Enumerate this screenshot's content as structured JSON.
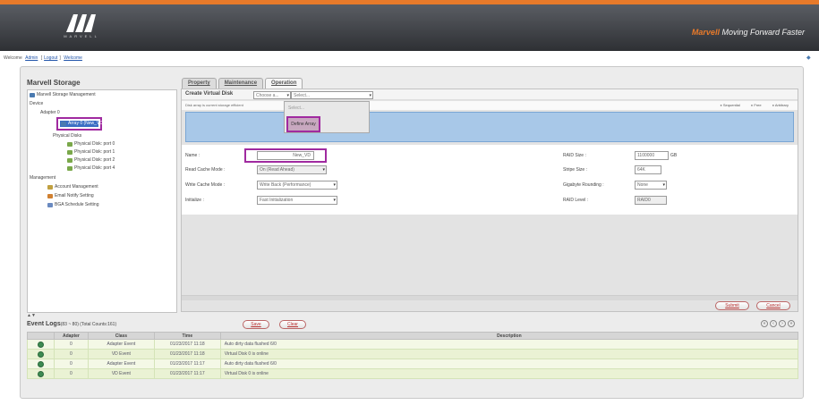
{
  "header": {
    "logo_text": "MARVELL",
    "tagline_brand": "Marvell",
    "tagline": "Moving Forward Faster"
  },
  "welcome": {
    "prefix": "Welcome",
    "user": "Admin",
    "logout": "Logout",
    "extra": "Welcome"
  },
  "left": {
    "title": "Marvell Storage",
    "tree": [
      {
        "label": "Marvell Storage Management",
        "icon": "tree-root-icon"
      },
      {
        "label": "Device",
        "icon": ""
      },
      {
        "label": "Adapter 0",
        "icon": ""
      },
      {
        "label": "Array 0 (New_VD)",
        "icon": "virtual-disk-icon"
      },
      {
        "label": "Physical Disks",
        "icon": ""
      },
      {
        "label": "Physical Disk: port 0",
        "icon": "physical-disk-icon"
      },
      {
        "label": "Physical Disk: port 1",
        "icon": "physical-disk-icon"
      },
      {
        "label": "Physical Disk: port 2",
        "icon": "physical-disk-icon"
      },
      {
        "label": "Physical Disk: port 4",
        "icon": "physical-disk-icon"
      },
      {
        "label": "Management",
        "icon": ""
      },
      {
        "label": "Account Management",
        "icon": "account-icon"
      },
      {
        "label": "Email Notify Setting",
        "icon": "email-icon"
      },
      {
        "label": "BGA Schedule Setting",
        "icon": "schedule-icon"
      }
    ]
  },
  "tabs": [
    {
      "label": "Property"
    },
    {
      "label": "Maintenance"
    },
    {
      "label": "Operation"
    }
  ],
  "create_vd": {
    "label": "Create Virtual Disk",
    "select1": "Choose a...",
    "select2": "Select...",
    "info": "Disk array is current storage efficient",
    "radios": [
      "Sequential",
      "Free",
      "Arbitrary"
    ],
    "menu_item_disabled": "Select...",
    "define_button": "Define Array"
  },
  "form": {
    "name_label": "Name :",
    "name_value": "New_VD",
    "read_cache_label": "Read Cache Mode :",
    "read_cache_value": "On (Read Ahead)",
    "write_cache_label": "Write Cache Mode :",
    "write_cache_value": "Write Back (Performance)",
    "initialize_label": "Initialize :",
    "initialize_value": "Fast Initialization",
    "raid_size_label": "RAID Size :",
    "raid_size_value": "1100000",
    "raid_size_unit": "GB",
    "stripe_label": "Stripe Size :",
    "stripe_value": "64K",
    "gigabyte_label": "Gigabyte Rounding :",
    "gigabyte_value": "None",
    "raid_level_label": "RAID Level :",
    "raid_level_value": "RAID0"
  },
  "actions": {
    "submit": "Submit",
    "cancel": "Cancel"
  },
  "events": {
    "title": "Event Logs",
    "count": "(83 ~ 80) (Total Counts:161)",
    "save": "Save",
    "clear": "Clear",
    "columns": [
      "Adapter",
      "Class",
      "Time",
      "Description"
    ],
    "rows": [
      {
        "adapter": "0",
        "class": "Adapter Event",
        "time": "01/23/2017 11:18",
        "desc": "Auto dirty data flushed 6/0"
      },
      {
        "adapter": "0",
        "class": "VD Event",
        "time": "01/23/2017 11:18",
        "desc": "Virtual Disk 0 is online"
      },
      {
        "adapter": "0",
        "class": "Adapter Event",
        "time": "01/23/2017 11:17",
        "desc": "Auto dirty data flushed 6/0"
      },
      {
        "adapter": "0",
        "class": "VD Event",
        "time": "01/23/2017 11:17",
        "desc": "Virtual Disk 0 is online"
      }
    ]
  }
}
